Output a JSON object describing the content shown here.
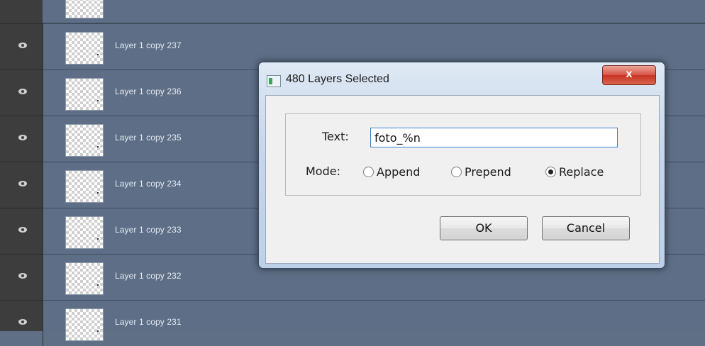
{
  "layers": [
    {
      "label": ""
    },
    {
      "label": "Layer 1 copy 237"
    },
    {
      "label": "Layer 1 copy 236"
    },
    {
      "label": "Layer 1 copy 235"
    },
    {
      "label": "Layer 1 copy 234"
    },
    {
      "label": "Layer 1 copy 233"
    },
    {
      "label": "Layer 1 copy 232"
    },
    {
      "label": "Layer 1 copy 231"
    }
  ],
  "dialog": {
    "title": "480 Layers Selected",
    "close_label": "x",
    "text_label": "Text:",
    "text_value": "foto_%n",
    "mode_label": "Mode:",
    "modes": [
      {
        "label": "Append",
        "selected": false
      },
      {
        "label": "Prepend",
        "selected": false
      },
      {
        "label": "Replace",
        "selected": true
      }
    ],
    "ok_label": "OK",
    "cancel_label": "Cancel"
  },
  "colors": {
    "panel_bg": "#5d6e86",
    "eye_column": "#3d3d3d",
    "close_button": "#c63325"
  }
}
